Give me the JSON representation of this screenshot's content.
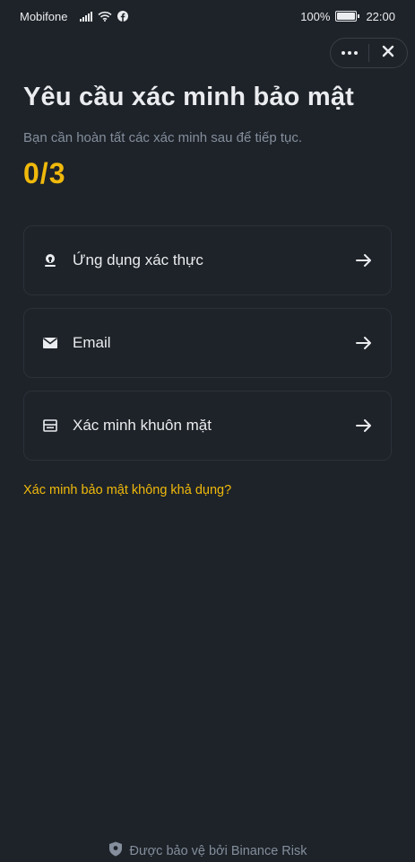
{
  "status_bar": {
    "carrier": "Mobifone",
    "battery": "100%",
    "time": "22:00",
    "battery_level": 1.0
  },
  "header": {
    "more_icon": "more-dots-icon",
    "close_icon": "close-icon"
  },
  "main": {
    "title": "Yêu cầu xác minh bảo mật",
    "subtitle": "Bạn cần hoàn tất các xác minh sau để tiếp tục.",
    "progress": "0/3",
    "methods": [
      {
        "label": "Ứng dụng xác thực",
        "icon": "authenticator-icon"
      },
      {
        "label": "Email",
        "icon": "envelope-icon"
      },
      {
        "label": "Xác minh khuôn mặt",
        "icon": "face-verification-icon"
      }
    ],
    "unavailable_link": "Xác minh bảo mật không khả dụng?"
  },
  "footer": {
    "text": "Được bảo vệ bởi Binance Risk",
    "icon": "shield-icon"
  },
  "colors": {
    "background": "#1e2329",
    "accent": "#f0b90b",
    "text_primary": "#eaecef",
    "text_secondary": "#848e9c",
    "card_border": "#2b3139"
  }
}
